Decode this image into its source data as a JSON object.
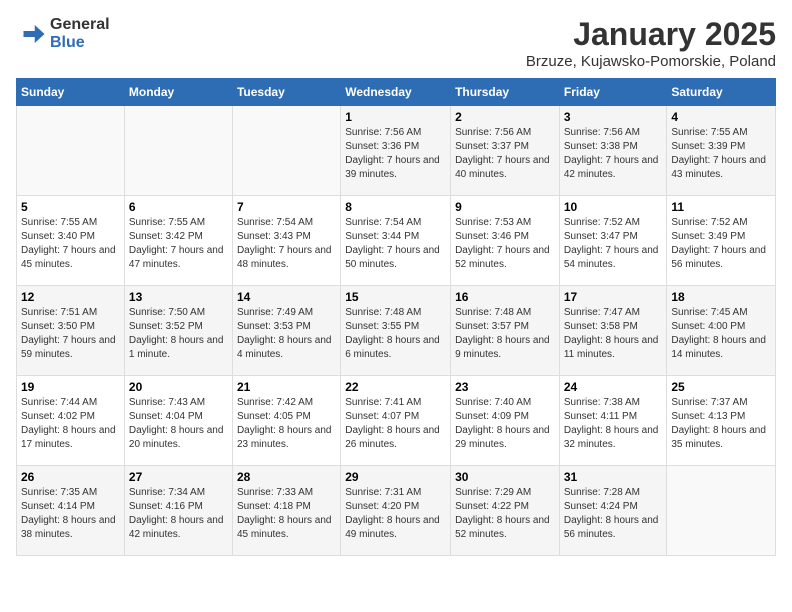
{
  "logo": {
    "general": "General",
    "blue": "Blue"
  },
  "title": "January 2025",
  "subtitle": "Brzuze, Kujawsko-Pomorskie, Poland",
  "headers": [
    "Sunday",
    "Monday",
    "Tuesday",
    "Wednesday",
    "Thursday",
    "Friday",
    "Saturday"
  ],
  "weeks": [
    [
      {
        "day": "",
        "content": ""
      },
      {
        "day": "",
        "content": ""
      },
      {
        "day": "",
        "content": ""
      },
      {
        "day": "1",
        "content": "Sunrise: 7:56 AM\nSunset: 3:36 PM\nDaylight: 7 hours and 39 minutes."
      },
      {
        "day": "2",
        "content": "Sunrise: 7:56 AM\nSunset: 3:37 PM\nDaylight: 7 hours and 40 minutes."
      },
      {
        "day": "3",
        "content": "Sunrise: 7:56 AM\nSunset: 3:38 PM\nDaylight: 7 hours and 42 minutes."
      },
      {
        "day": "4",
        "content": "Sunrise: 7:55 AM\nSunset: 3:39 PM\nDaylight: 7 hours and 43 minutes."
      }
    ],
    [
      {
        "day": "5",
        "content": "Sunrise: 7:55 AM\nSunset: 3:40 PM\nDaylight: 7 hours and 45 minutes."
      },
      {
        "day": "6",
        "content": "Sunrise: 7:55 AM\nSunset: 3:42 PM\nDaylight: 7 hours and 47 minutes."
      },
      {
        "day": "7",
        "content": "Sunrise: 7:54 AM\nSunset: 3:43 PM\nDaylight: 7 hours and 48 minutes."
      },
      {
        "day": "8",
        "content": "Sunrise: 7:54 AM\nSunset: 3:44 PM\nDaylight: 7 hours and 50 minutes."
      },
      {
        "day": "9",
        "content": "Sunrise: 7:53 AM\nSunset: 3:46 PM\nDaylight: 7 hours and 52 minutes."
      },
      {
        "day": "10",
        "content": "Sunrise: 7:52 AM\nSunset: 3:47 PM\nDaylight: 7 hours and 54 minutes."
      },
      {
        "day": "11",
        "content": "Sunrise: 7:52 AM\nSunset: 3:49 PM\nDaylight: 7 hours and 56 minutes."
      }
    ],
    [
      {
        "day": "12",
        "content": "Sunrise: 7:51 AM\nSunset: 3:50 PM\nDaylight: 7 hours and 59 minutes."
      },
      {
        "day": "13",
        "content": "Sunrise: 7:50 AM\nSunset: 3:52 PM\nDaylight: 8 hours and 1 minute."
      },
      {
        "day": "14",
        "content": "Sunrise: 7:49 AM\nSunset: 3:53 PM\nDaylight: 8 hours and 4 minutes."
      },
      {
        "day": "15",
        "content": "Sunrise: 7:48 AM\nSunset: 3:55 PM\nDaylight: 8 hours and 6 minutes."
      },
      {
        "day": "16",
        "content": "Sunrise: 7:48 AM\nSunset: 3:57 PM\nDaylight: 8 hours and 9 minutes."
      },
      {
        "day": "17",
        "content": "Sunrise: 7:47 AM\nSunset: 3:58 PM\nDaylight: 8 hours and 11 minutes."
      },
      {
        "day": "18",
        "content": "Sunrise: 7:45 AM\nSunset: 4:00 PM\nDaylight: 8 hours and 14 minutes."
      }
    ],
    [
      {
        "day": "19",
        "content": "Sunrise: 7:44 AM\nSunset: 4:02 PM\nDaylight: 8 hours and 17 minutes."
      },
      {
        "day": "20",
        "content": "Sunrise: 7:43 AM\nSunset: 4:04 PM\nDaylight: 8 hours and 20 minutes."
      },
      {
        "day": "21",
        "content": "Sunrise: 7:42 AM\nSunset: 4:05 PM\nDaylight: 8 hours and 23 minutes."
      },
      {
        "day": "22",
        "content": "Sunrise: 7:41 AM\nSunset: 4:07 PM\nDaylight: 8 hours and 26 minutes."
      },
      {
        "day": "23",
        "content": "Sunrise: 7:40 AM\nSunset: 4:09 PM\nDaylight: 8 hours and 29 minutes."
      },
      {
        "day": "24",
        "content": "Sunrise: 7:38 AM\nSunset: 4:11 PM\nDaylight: 8 hours and 32 minutes."
      },
      {
        "day": "25",
        "content": "Sunrise: 7:37 AM\nSunset: 4:13 PM\nDaylight: 8 hours and 35 minutes."
      }
    ],
    [
      {
        "day": "26",
        "content": "Sunrise: 7:35 AM\nSunset: 4:14 PM\nDaylight: 8 hours and 38 minutes."
      },
      {
        "day": "27",
        "content": "Sunrise: 7:34 AM\nSunset: 4:16 PM\nDaylight: 8 hours and 42 minutes."
      },
      {
        "day": "28",
        "content": "Sunrise: 7:33 AM\nSunset: 4:18 PM\nDaylight: 8 hours and 45 minutes."
      },
      {
        "day": "29",
        "content": "Sunrise: 7:31 AM\nSunset: 4:20 PM\nDaylight: 8 hours and 49 minutes."
      },
      {
        "day": "30",
        "content": "Sunrise: 7:29 AM\nSunset: 4:22 PM\nDaylight: 8 hours and 52 minutes."
      },
      {
        "day": "31",
        "content": "Sunrise: 7:28 AM\nSunset: 4:24 PM\nDaylight: 8 hours and 56 minutes."
      },
      {
        "day": "",
        "content": ""
      }
    ]
  ]
}
